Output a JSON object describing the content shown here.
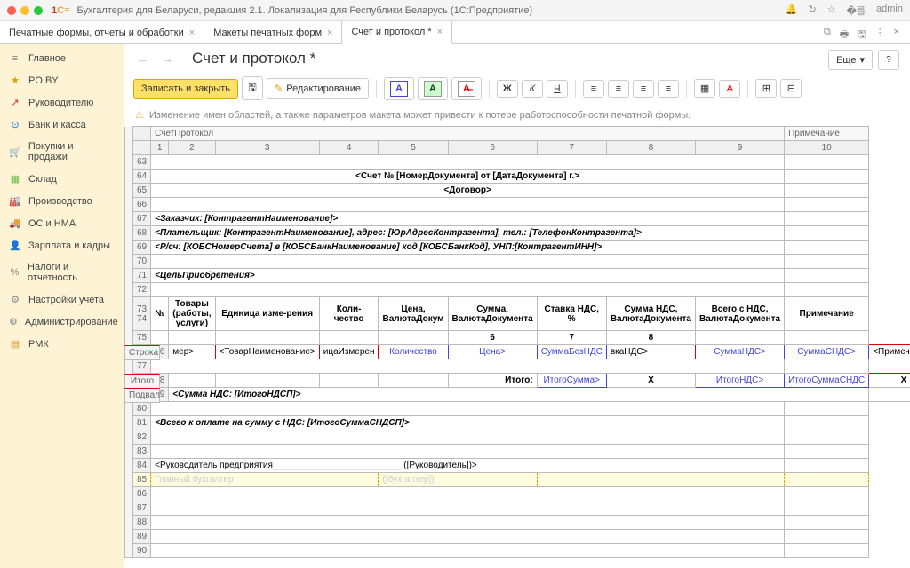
{
  "titlebar": {
    "app": "1C",
    "title": "Бухгалтерия для Беларуси, редакция 2.1. Локализация для Республики Беларусь   (1С:Предприятие)",
    "user": "admin"
  },
  "tabs": [
    {
      "label": "Печатные формы, отчеты и обработки"
    },
    {
      "label": "Макеты печатных форм"
    },
    {
      "label": "Счет и протокол *",
      "active": true
    }
  ],
  "sidebar": [
    {
      "icon": "≡",
      "label": "Главное"
    },
    {
      "icon": "★",
      "label": "PO.BY"
    },
    {
      "icon": "↗",
      "label": "Руководителю"
    },
    {
      "icon": "⊙",
      "label": "Банк и касса"
    },
    {
      "icon": "🛒",
      "label": "Покупки и продажи"
    },
    {
      "icon": "▦",
      "label": "Склад"
    },
    {
      "icon": "🏭",
      "label": "Производство"
    },
    {
      "icon": "🚚",
      "label": "ОС и НМА"
    },
    {
      "icon": "👤",
      "label": "Зарплата и кадры"
    },
    {
      "icon": "%",
      "label": "Налоги и отчетность"
    },
    {
      "icon": "⚙",
      "label": "Настройки учета"
    },
    {
      "icon": "⚙",
      "label": "Администрирование"
    },
    {
      "icon": "▤",
      "label": "РМК"
    }
  ],
  "page": {
    "title": "Счет и протокол *"
  },
  "toolbar": {
    "save": "Записать и закрыть",
    "edit": "Редактирование",
    "more": "Еще"
  },
  "warning": "Изменение имен областей, а также параметров макета может привести к потере работоспособности печатной формы.",
  "areas": {
    "header": "СчетПротокол",
    "note": "Примечание",
    "row": "Строка",
    "total": "Итого",
    "footer": "Подвал"
  },
  "cols": [
    "1",
    "2",
    "3",
    "4",
    "5",
    "6",
    "7",
    "8",
    "9",
    "10"
  ],
  "doc": {
    "title": "<Счет № [НомерДокумента] от [ДатаДокумента] г.>",
    "contract": "<Договор>",
    "customer": "<Заказчик: [КонтрагентНаименование]>",
    "payer": "<Плательщик: [КонтрагентНаименование], адрес: [ЮрАдресКонтрагента], тел.: [ТелефонКонтрагента]>",
    "account": "<Р/сч: [КОБСНомерСчета] в [КОБСБанкНаименование] код [КОБСБанкКод], УНП:[КонтрагентИНН]>",
    "purpose": "<ЦельПриобретения>",
    "th": {
      "num": "№",
      "goods": "Товары (работы, услуги)",
      "unit": "Единица изме-рения",
      "qty": "Коли-чество",
      "price": "Цена, ВалютаДокум",
      "sum": "Сумма, ВалютаДокумента",
      "rate": "Ставка НДС, %",
      "vat": "Сумма НДС, ВалютаДокумента",
      "total": "Всего с НДС, ВалютаДокумента",
      "note": "Примечание"
    },
    "row": {
      "num": "мер>",
      "name": "<ТоварНаименование>",
      "unit": "ицаИзмерен",
      "qty": "Количество",
      "price": "Цена>",
      "sum": "СуммаБезНДС",
      "rate": "вкаНДС>",
      "vat": "СуммаНДС>",
      "total": "СуммаСНДС>",
      "note": "<Примечание>"
    },
    "totals": {
      "label": "Итого:",
      "sum": "ИтогоСумма>",
      "x": "X",
      "vat": "ИтогоНДС>",
      "total": "ИтогоСуммаСНДС"
    },
    "vatline": "<Сумма НДС: [ИтогоНДСП]>",
    "grandline": "<Всего к оплате  на сумму с НДС: [ИтогоСуммаСНДСП]>",
    "sign1": "<Руководитель предприятия__________________________ ([Руководитель])>",
    "sign2a": "Главный бухгалтер",
    "sign2b": "([бухгалтер])"
  },
  "subcols": [
    "",
    "",
    "",
    "",
    "",
    "6",
    "7",
    "8"
  ]
}
